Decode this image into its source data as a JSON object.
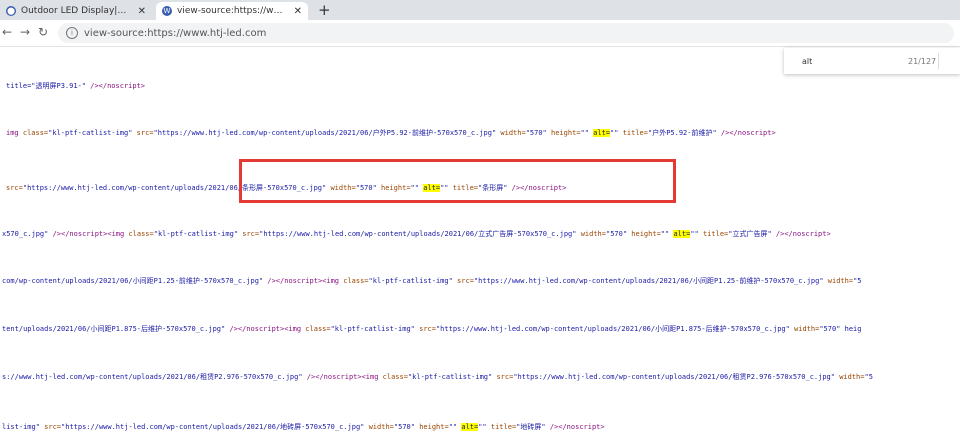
{
  "tabs": [
    {
      "title": "Outdoor LED Display|Stage LED",
      "favicon": "site-favicon",
      "active": false
    },
    {
      "title": "view-source:https://www.htj-led",
      "favicon": "wordpress-favicon",
      "active": true
    }
  ],
  "new_tab_label": "+",
  "address": {
    "url": "view-source:https://www.htj-led.com"
  },
  "find": {
    "query": "alt",
    "count": "21/127"
  },
  "source_lines": [
    [
      [
        "val",
        "title=\"透明屏P3.91-\""
      ],
      [
        "tag",
        " /></noscript>"
      ]
    ],
    [
      [
        "tag",
        "img "
      ],
      [
        "attr",
        "class="
      ],
      [
        "val",
        "\"kl-ptf-catlist-img\" "
      ],
      [
        "attr",
        "src="
      ],
      [
        "val",
        "\"https://www.htj-led.com/wp-content/uploads/2021/06/户外P5.92-前维护-570x570_c.jpg\" "
      ],
      [
        "attr",
        "width="
      ],
      [
        "val",
        "\"570\" "
      ],
      [
        "attr",
        "height="
      ],
      [
        "val",
        "\"\" "
      ],
      [
        "hl",
        "alt="
      ],
      [
        "val",
        "\"\"  "
      ],
      [
        "attr",
        "title="
      ],
      [
        "val",
        "\"户外P5.92-前维护\""
      ],
      [
        "tag",
        " /></noscript>"
      ]
    ],
    [
      [
        "attr",
        "src="
      ],
      [
        "val",
        "\"https://www.htj-led.com/wp-content/uploads/2021/06/条形屏-570x570_c.jpg\" "
      ],
      [
        "attr",
        "width="
      ],
      [
        "val",
        "\"570\" "
      ],
      [
        "attr",
        "height="
      ],
      [
        "val",
        "\"\" "
      ],
      [
        "hl",
        "alt="
      ],
      [
        "val",
        "\"\"  "
      ],
      [
        "attr",
        "title="
      ],
      [
        "val",
        "\"条形屏\""
      ],
      [
        "tag",
        " /></noscript>"
      ]
    ],
    [
      [
        "val",
        "x570_c.jpg\" "
      ],
      [
        "tag",
        "/></noscript><img "
      ],
      [
        "attr",
        "class="
      ],
      [
        "val",
        "\"kl-ptf-catlist-img\" "
      ],
      [
        "attr",
        "src="
      ],
      [
        "val",
        "\"https://www.htj-led.com/wp-content/uploads/2021/06/立式广告屏-570x570_c.jpg\" "
      ],
      [
        "attr",
        "width="
      ],
      [
        "val",
        "\"570\" "
      ],
      [
        "attr",
        "height="
      ],
      [
        "val",
        "\"\" "
      ],
      [
        "hl",
        "alt="
      ],
      [
        "val",
        "\"\"  "
      ],
      [
        "attr",
        "title="
      ],
      [
        "val",
        "\"立式广告屏\""
      ],
      [
        "tag",
        " /></noscript>"
      ]
    ],
    [
      [
        "val",
        "com/wp-content/uploads/2021/06/小间距P1.25-前维护-570x570_c.jpg\" "
      ],
      [
        "tag",
        "/></noscript><img "
      ],
      [
        "attr",
        "class="
      ],
      [
        "val",
        "\"kl-ptf-catlist-img\" "
      ],
      [
        "attr",
        "src="
      ],
      [
        "val",
        "\"https://www.htj-led.com/wp-content/uploads/2021/06/小间距P1.25-前维护-570x570_c.jpg\" "
      ],
      [
        "attr",
        "width="
      ],
      [
        "val",
        "\"5"
      ]
    ],
    [
      [
        "val",
        "tent/uploads/2021/06/小间距P1.875-后维护-570x570_c.jpg\" "
      ],
      [
        "tag",
        "/></noscript><img "
      ],
      [
        "attr",
        "class="
      ],
      [
        "val",
        "\"kl-ptf-catlist-img\" "
      ],
      [
        "attr",
        "src="
      ],
      [
        "val",
        "\"https://www.htj-led.com/wp-content/uploads/2021/06/小间距P1.875-后维护-570x570_c.jpg\" "
      ],
      [
        "attr",
        "width="
      ],
      [
        "val",
        "\"570\" heig"
      ]
    ],
    [
      [
        "val",
        "s://www.htj-led.com/wp-content/uploads/2021/06/租赁P2.976-570x570_c.jpg\" "
      ],
      [
        "tag",
        "/></noscript><img "
      ],
      [
        "attr",
        "class="
      ],
      [
        "val",
        "\"kl-ptf-catlist-img\" "
      ],
      [
        "attr",
        "src="
      ],
      [
        "val",
        "\"https://www.htj-led.com/wp-content/uploads/2021/06/租赁P2.976-570x570_c.jpg\" "
      ],
      [
        "attr",
        "width="
      ],
      [
        "val",
        "\"5"
      ]
    ],
    [
      [
        "val",
        "list-img\" "
      ],
      [
        "attr",
        "src="
      ],
      [
        "val",
        "\"https://www.htj-led.com/wp-content/uploads/2021/06/地砖屏-570x570_c.jpg\" "
      ],
      [
        "attr",
        "width="
      ],
      [
        "val",
        "\"570\" "
      ],
      [
        "attr",
        "height="
      ],
      [
        "val",
        "\"\" "
      ],
      [
        "hl",
        "alt="
      ],
      [
        "val",
        "\"\"  "
      ],
      [
        "attr",
        "title="
      ],
      [
        "val",
        "\"地砖屏\""
      ],
      [
        "tag",
        " /></noscript>"
      ]
    ]
  ]
}
